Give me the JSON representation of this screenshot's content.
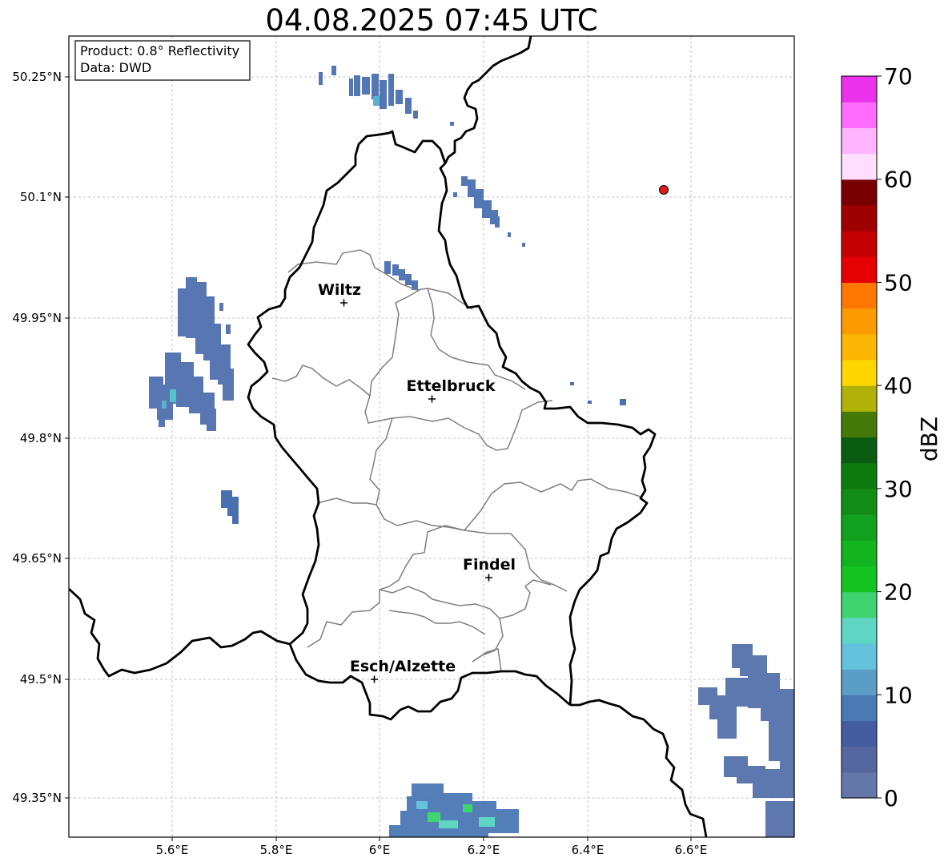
{
  "title": "04.08.2025 07:45 UTC",
  "info": {
    "product": "Product: 0.8° Reflectivity",
    "data_source": "Data: DWD"
  },
  "axes": {
    "lon_ticks": [
      "5.6°E",
      "5.8°E",
      "6°E",
      "6.2°E",
      "6.4°E",
      "6.6°E"
    ],
    "lat_ticks": [
      "50.25°N",
      "50.1°N",
      "49.95°N",
      "49.8°N",
      "49.65°N",
      "49.5°N",
      "49.35°N"
    ]
  },
  "cities": [
    {
      "name": "Wiltz"
    },
    {
      "name": "Ettelbruck"
    },
    {
      "name": "Findel"
    },
    {
      "name": "Esch/Alzette"
    }
  ],
  "colorbar": {
    "label": "dBZ",
    "ticks": [
      "0",
      "10",
      "20",
      "30",
      "40",
      "50",
      "60",
      "70"
    ],
    "colors": [
      "#6477a8",
      "#56679f",
      "#435da0",
      "#4a79b3",
      "#5a9ec8",
      "#65c2dc",
      "#5fd6c4",
      "#3ed470",
      "#13c321",
      "#12b41f",
      "#12a11e",
      "#138c17",
      "#0d7b0f",
      "#0a5d10",
      "#457a0b",
      "#b0b209",
      "#fed600",
      "#fdb604",
      "#fc9a02",
      "#fe7801",
      "#e50003",
      "#c40005",
      "#9f0103",
      "#780001",
      "#ffdfff",
      "#ffb5ff",
      "#ff6cfe",
      "#ea32ea"
    ]
  },
  "marker_color": "#e31a1c"
}
